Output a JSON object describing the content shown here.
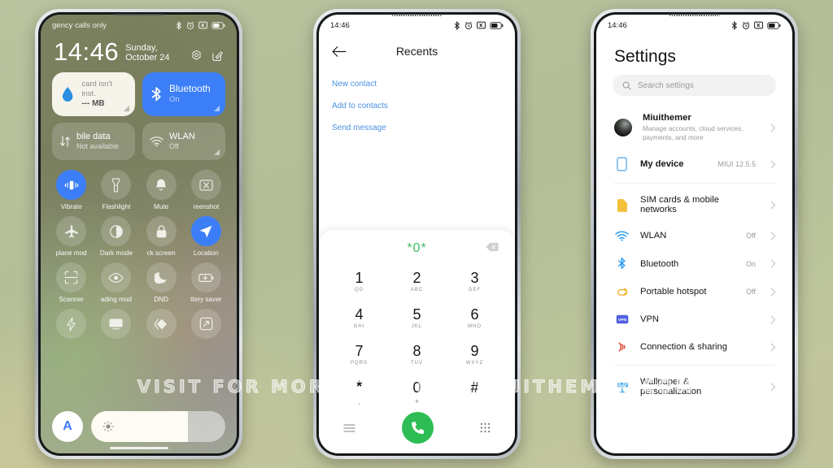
{
  "watermark": "VISIT FOR MORE THEMES - MIUITHEMER.COM",
  "phone1": {
    "statusbar": {
      "left_text": "gency calls only",
      "icons": [
        "bluetooth-icon",
        "alarm-icon",
        "screenshot-icon",
        "battery-icon"
      ]
    },
    "clock": {
      "time": "14:46",
      "date": "Sunday, October 24"
    },
    "header_icons": [
      "settings-gear-icon",
      "edit-icon"
    ],
    "big_tiles": [
      {
        "icon": "water-drop-icon",
        "title": "card isn't inst.",
        "sub": "--- MB"
      },
      {
        "icon": "bluetooth-icon",
        "title": "Bluetooth",
        "sub": "On"
      }
    ],
    "mid_tiles": [
      {
        "icon": "mobile-data-icon",
        "title": "bile data",
        "sub": "Not available"
      },
      {
        "icon": "wlan-icon",
        "title": "WLAN",
        "sub": "Off"
      }
    ],
    "toggles": [
      {
        "label": "Vibrate",
        "icon": "vibrate-icon",
        "on": true
      },
      {
        "label": "Flashlight",
        "icon": "flashlight-icon",
        "on": false
      },
      {
        "label": "Mute",
        "icon": "bell-icon",
        "on": false
      },
      {
        "label": "reenshot",
        "icon": "screenshot-icon",
        "on": false
      },
      {
        "label": "plane mod",
        "icon": "airplane-icon",
        "on": false
      },
      {
        "label": "Dark mode",
        "icon": "dark-mode-icon",
        "on": false
      },
      {
        "label": "ck screen",
        "icon": "lock-icon",
        "on": false
      },
      {
        "label": "Location",
        "icon": "location-icon",
        "on": true
      },
      {
        "label": "Scanner",
        "icon": "scanner-icon",
        "on": false
      },
      {
        "label": "ading mod",
        "icon": "eye-icon",
        "on": false
      },
      {
        "label": "DND",
        "icon": "moon-icon",
        "on": false
      },
      {
        "label": "ttery saver",
        "icon": "battery-saver-icon",
        "on": false
      },
      {
        "label": "",
        "icon": "bolt-icon",
        "on": false
      },
      {
        "label": "",
        "icon": "cast-icon",
        "on": false
      },
      {
        "label": "",
        "icon": "nfc-icon",
        "on": false
      },
      {
        "label": "",
        "icon": "rotate-icon",
        "on": false
      }
    ],
    "brightness": {
      "auto_label": "A",
      "icon": "brightness-icon",
      "level": "72"
    }
  },
  "phone2": {
    "statusbar": {
      "time": "14:46",
      "icons": [
        "bluetooth-icon",
        "alarm-icon",
        "screenshot-icon",
        "battery-icon"
      ]
    },
    "title": "Recents",
    "back_icon": "back-arrow-icon",
    "links": [
      "New contact",
      "Add to contacts",
      "Send message"
    ],
    "dialer": {
      "number": "*0*",
      "delete_icon": "backspace-icon",
      "keys": [
        {
          "digit": "1",
          "letters": "QD"
        },
        {
          "digit": "2",
          "letters": "ABC"
        },
        {
          "digit": "3",
          "letters": "DEF"
        },
        {
          "digit": "4",
          "letters": "GHI"
        },
        {
          "digit": "5",
          "letters": "JKL"
        },
        {
          "digit": "6",
          "letters": "MNO"
        },
        {
          "digit": "7",
          "letters": "PQRS"
        },
        {
          "digit": "8",
          "letters": "TUV"
        },
        {
          "digit": "9",
          "letters": "WXYZ"
        },
        {
          "digit": "*",
          "letters": ","
        },
        {
          "digit": "0",
          "letters": "+"
        },
        {
          "digit": "#",
          "letters": ""
        }
      ],
      "actions": [
        "menu-icon",
        "call-button",
        "keypad-icon"
      ]
    }
  },
  "phone3": {
    "statusbar": {
      "time": "14:46",
      "icons": [
        "bluetooth-icon",
        "alarm-icon",
        "screenshot-icon",
        "battery-icon"
      ]
    },
    "title": "Settings",
    "search": {
      "placeholder": "Search settings",
      "icon": "search-icon"
    },
    "account": {
      "name": "Miuithemer",
      "desc": "Manage accounts, cloud services, payments, and more"
    },
    "rows": [
      {
        "icon": "device-icon",
        "name": "My device",
        "value": "MIUI 12.5.5",
        "bold": true
      },
      {
        "icon": "sim-icon",
        "name": "SIM cards & mobile networks",
        "value": "",
        "bold": false
      },
      {
        "icon": "wlan-icon",
        "name": "WLAN",
        "value": "Off",
        "bold": false
      },
      {
        "icon": "bluetooth-icon",
        "name": "Bluetooth",
        "value": "On",
        "bold": false
      },
      {
        "icon": "hotspot-icon",
        "name": "Portable hotspot",
        "value": "Off",
        "bold": false
      },
      {
        "icon": "vpn-icon",
        "name": "VPN",
        "value": "",
        "bold": false
      },
      {
        "icon": "connection-icon",
        "name": "Connection & sharing",
        "value": "",
        "bold": false
      },
      {
        "icon": "wallpaper-icon",
        "name": "Wallpaper & personalization",
        "value": "",
        "bold": false
      }
    ]
  },
  "colors": {
    "accent_blue": "#3b7ef7",
    "link_blue": "#4a90e2",
    "call_green": "#2dbd54",
    "dial_green": "#3fbf63",
    "background": "#b3be97"
  }
}
